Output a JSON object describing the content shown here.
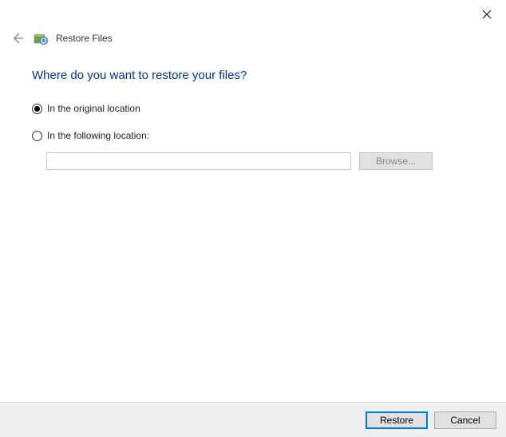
{
  "window": {
    "title": "Restore Files"
  },
  "heading": "Where do you want to restore your files?",
  "options": {
    "original": "In the original location",
    "following": "In the following location:"
  },
  "path_input": {
    "value": "",
    "placeholder": ""
  },
  "buttons": {
    "browse": "Browse...",
    "restore": "Restore",
    "cancel": "Cancel"
  }
}
